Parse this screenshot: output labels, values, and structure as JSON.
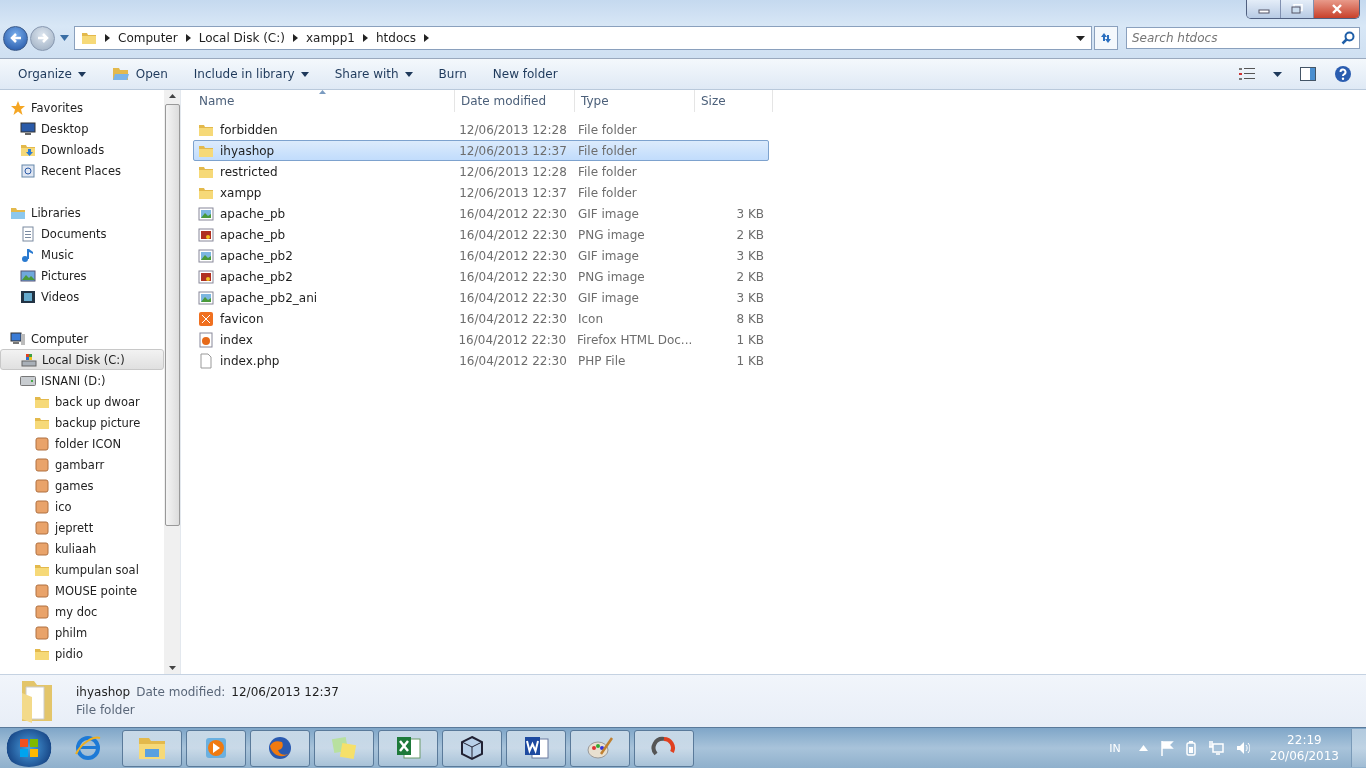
{
  "address_bar": {
    "breadcrumbs": [
      "Computer",
      "Local Disk (C:)",
      "xampp1",
      "htdocs"
    ]
  },
  "search": {
    "placeholder": "Search htdocs"
  },
  "toolbar": [
    {
      "label": "Organize",
      "kind": "menu"
    },
    {
      "label": "Open",
      "kind": "open"
    },
    {
      "label": "Include in library",
      "kind": "menu"
    },
    {
      "label": "Share with",
      "kind": "menu"
    },
    {
      "label": "Burn",
      "kind": "plain"
    },
    {
      "label": "New folder",
      "kind": "plain"
    }
  ],
  "sidebar": {
    "sections": [
      {
        "label": "Favorites",
        "kind": "star",
        "selected": false,
        "children": [
          {
            "label": "Desktop",
            "kind": "desktop",
            "selected": false
          },
          {
            "label": "Downloads",
            "kind": "downloads",
            "selected": false
          },
          {
            "label": "Recent Places",
            "kind": "recent",
            "selected": false
          }
        ]
      },
      {
        "label": "Libraries",
        "kind": "library",
        "selected": false,
        "children": [
          {
            "label": "Documents",
            "kind": "document",
            "selected": false
          },
          {
            "label": "Music",
            "kind": "music",
            "selected": false
          },
          {
            "label": "Pictures",
            "kind": "picture",
            "selected": false
          },
          {
            "label": "Videos",
            "kind": "video",
            "selected": false
          }
        ]
      },
      {
        "label": "Computer",
        "kind": "computer",
        "selected": false,
        "children": [
          {
            "label": "Local Disk (C:)",
            "kind": "disk",
            "selected": true
          },
          {
            "label": "ISNANI (D:)",
            "kind": "drive",
            "selected": false,
            "children": [
              {
                "label": "back up dwoar",
                "kind": "folder",
                "selected": false
              },
              {
                "label": "backup picture",
                "kind": "folder",
                "selected": false
              },
              {
                "label": "folder ICON",
                "kind": "custom",
                "selected": false
              },
              {
                "label": "gambarr",
                "kind": "custom",
                "selected": false
              },
              {
                "label": "games",
                "kind": "custom",
                "selected": false
              },
              {
                "label": "ico",
                "kind": "custom",
                "selected": false
              },
              {
                "label": "jeprett",
                "kind": "custom",
                "selected": false
              },
              {
                "label": "kuliaah",
                "kind": "custom",
                "selected": false
              },
              {
                "label": "kumpulan soal",
                "kind": "folder",
                "selected": false
              },
              {
                "label": "MOUSE pointe",
                "kind": "custom",
                "selected": false
              },
              {
                "label": "my doc",
                "kind": "custom",
                "selected": false
              },
              {
                "label": "philm",
                "kind": "custom",
                "selected": false
              },
              {
                "label": "pidio",
                "kind": "folder",
                "selected": false
              }
            ]
          }
        ]
      }
    ]
  },
  "file_list": {
    "columns": [
      "Name",
      "Date modified",
      "Type",
      "Size"
    ],
    "rows": [
      {
        "name": "forbidden",
        "date_modified": "12/06/2013 12:28",
        "type": "File folder",
        "size": "",
        "kind": "folder",
        "selected": false
      },
      {
        "name": "ihyashop",
        "date_modified": "12/06/2013 12:37",
        "type": "File folder",
        "size": "",
        "kind": "folder",
        "selected": true
      },
      {
        "name": "restricted",
        "date_modified": "12/06/2013 12:28",
        "type": "File folder",
        "size": "",
        "kind": "folder",
        "selected": false
      },
      {
        "name": "xampp",
        "date_modified": "12/06/2013 12:37",
        "type": "File folder",
        "size": "",
        "kind": "folder",
        "selected": false
      },
      {
        "name": "apache_pb",
        "date_modified": "16/04/2012 22:30",
        "type": "GIF image",
        "size": "3 KB",
        "kind": "gif",
        "selected": false
      },
      {
        "name": "apache_pb",
        "date_modified": "16/04/2012 22:30",
        "type": "PNG image",
        "size": "2 KB",
        "kind": "png",
        "selected": false
      },
      {
        "name": "apache_pb2",
        "date_modified": "16/04/2012 22:30",
        "type": "GIF image",
        "size": "3 KB",
        "kind": "gif",
        "selected": false
      },
      {
        "name": "apache_pb2",
        "date_modified": "16/04/2012 22:30",
        "type": "PNG image",
        "size": "2 KB",
        "kind": "png",
        "selected": false
      },
      {
        "name": "apache_pb2_ani",
        "date_modified": "16/04/2012 22:30",
        "type": "GIF image",
        "size": "3 KB",
        "kind": "gif",
        "selected": false
      },
      {
        "name": "favicon",
        "date_modified": "16/04/2012 22:30",
        "type": "Icon",
        "size": "8 KB",
        "kind": "ico",
        "selected": false
      },
      {
        "name": "index",
        "date_modified": "16/04/2012 22:30",
        "type": "Firefox HTML Doc...",
        "size": "1 KB",
        "kind": "html",
        "selected": false
      },
      {
        "name": "index.php",
        "date_modified": "16/04/2012 22:30",
        "type": "PHP File",
        "size": "1 KB",
        "kind": "php",
        "selected": false
      }
    ]
  },
  "details_pane": {
    "name": "ihyashop",
    "date_label": "Date modified:",
    "date": "12/06/2013 12:37",
    "type": "File folder"
  },
  "tray": {
    "language": "IN",
    "time": "22:19",
    "date": "20/06/2013"
  }
}
